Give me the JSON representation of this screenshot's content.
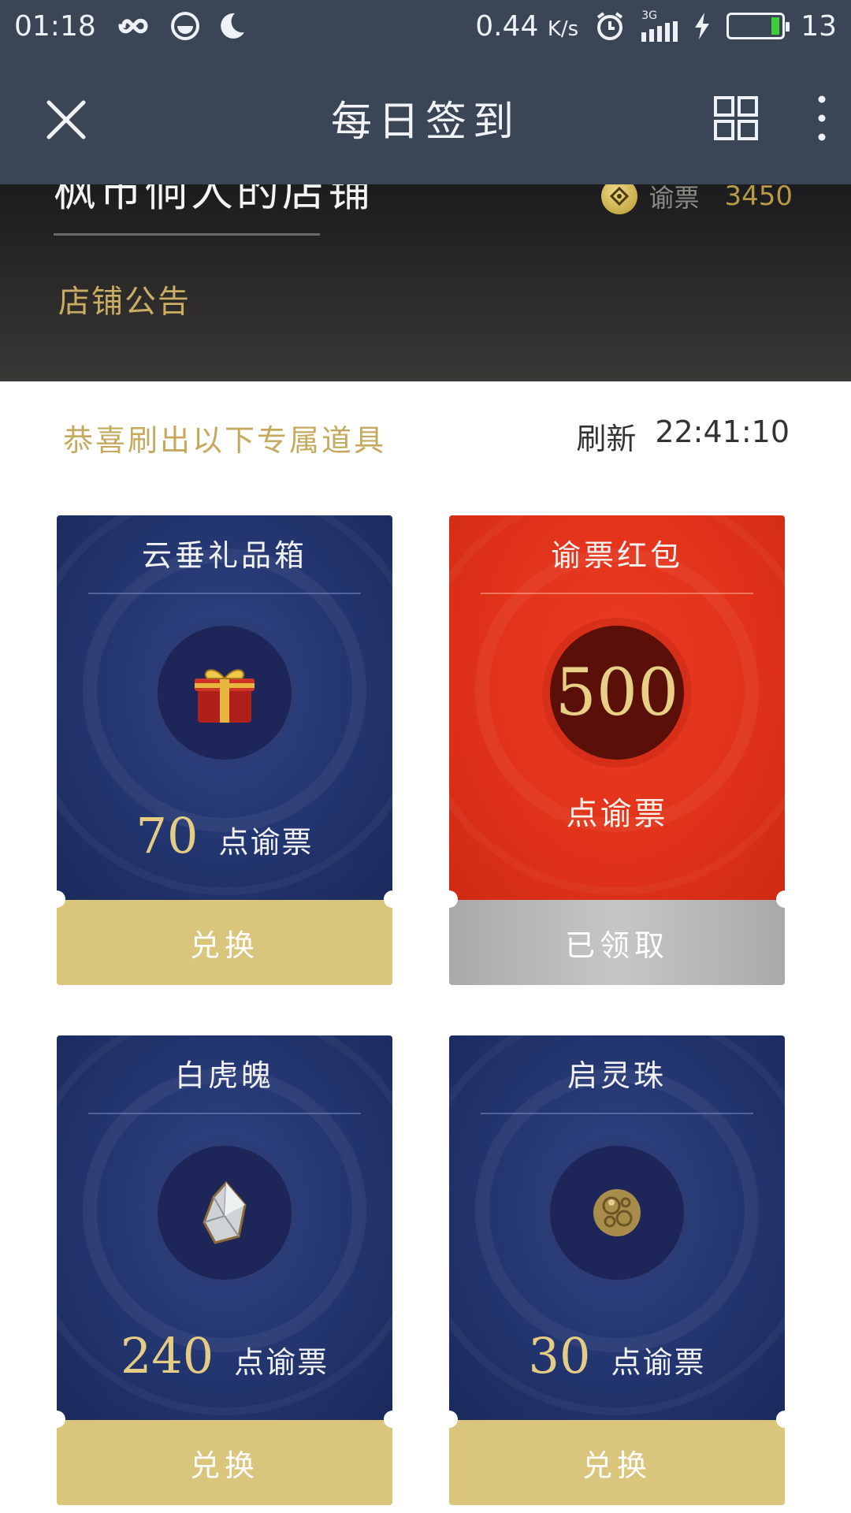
{
  "status_bar": {
    "time": "01:18",
    "net_speed": "0.44",
    "net_speed_unit": "K/s",
    "network_type": "3G",
    "battery_level": "13",
    "icons": [
      "infinity-icon",
      "browser-icon",
      "moon-icon",
      "alarm-icon",
      "signal-icon",
      "charging-icon",
      "battery-icon"
    ]
  },
  "header": {
    "title": "每日签到",
    "icons": [
      "close-icon",
      "grid-icon",
      "more-vertical-icon"
    ]
  },
  "shop": {
    "name": "枫市侗人的店铺",
    "notice_label": "店铺公告",
    "currency_label": "谕票",
    "currency_value": "3450"
  },
  "panel": {
    "congrats_text": "恭喜刷出以下专属道具",
    "refresh_label": "刷新",
    "refresh_time": "22:41:10"
  },
  "items": [
    {
      "name": "云垂礼品箱",
      "icon": "gift-box-icon",
      "price": "70",
      "unit": "点谕票",
      "button": "兑换",
      "status": "available"
    },
    {
      "name": "谕票红包",
      "amount": "500",
      "unit": "点谕票",
      "button": "已领取",
      "status": "claimed"
    },
    {
      "name": "白虎魄",
      "icon": "crystal-shard-icon",
      "price": "240",
      "unit": "点谕票",
      "button": "兑换",
      "status": "available"
    },
    {
      "name": "启灵珠",
      "icon": "spirit-orb-icon",
      "price": "30",
      "unit": "点谕票",
      "button": "兑换",
      "status": "available"
    }
  ],
  "colors": {
    "header_bg": "#3a4556",
    "gold_text": "#c5a95e",
    "card_blue": "#253873",
    "card_red": "#e1321a",
    "button_gold": "#d9c57c",
    "button_grey": "#b4b4b4"
  }
}
